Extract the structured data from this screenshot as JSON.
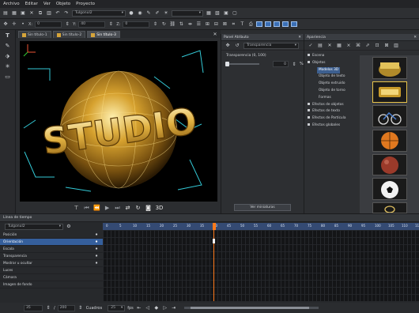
{
  "menu": [
    "Archivo",
    "Editar",
    "Ver",
    "Objeto",
    "Proyecto"
  ],
  "toolbar": {
    "font_value": "Tulgonul2"
  },
  "coords": {
    "x_label": "X:",
    "x_value": "0",
    "y_label": "Y:",
    "y_value": "40",
    "z_label": "Z:",
    "z_value": "0"
  },
  "tabs": [
    "Sin título-1",
    "Sin título-2",
    "Sin título-3"
  ],
  "viewport": {
    "text": "STUDIO",
    "mode_label": "3D"
  },
  "attr_panel": {
    "title": "Panel Atributo",
    "combo": "Transparencia",
    "label": "Transparencia (0, 100)",
    "value": "0",
    "unit": "%",
    "button": "Ver miniaturas"
  },
  "apariencia": {
    "title": "Apariencia",
    "tree": [
      {
        "label": "Escena",
        "level": 0
      },
      {
        "label": "Objetos",
        "level": 0
      },
      {
        "label": "Modelos 3D",
        "level": 1,
        "selected": true
      },
      {
        "label": "Objeto de texto",
        "level": 1
      },
      {
        "label": "Objeto extruido",
        "level": 1
      },
      {
        "label": "Objeto de torno",
        "level": 1
      },
      {
        "label": "Formas",
        "level": 1
      },
      {
        "label": "Efectos de objetos",
        "level": 0
      },
      {
        "label": "Efectos de texto",
        "level": 0
      },
      {
        "label": "Efectos de Partícula",
        "level": 0
      },
      {
        "label": "Efectos globales",
        "level": 0
      }
    ]
  },
  "thumbnails": [
    "studio-gold",
    "studio-badge",
    "bicycle",
    "basketball",
    "ball-red",
    "soccer-ball",
    "ring"
  ],
  "timeline": {
    "title": "Línea de tiempo",
    "object": "Tulgonul2",
    "tracks": [
      {
        "label": "Posición"
      },
      {
        "label": "Orientación",
        "selected": true
      },
      {
        "label": "Escala"
      },
      {
        "label": "Transparencia"
      },
      {
        "label": "Mostrar u ocultar"
      },
      {
        "label": "Luces"
      },
      {
        "label": "Cámara"
      },
      {
        "label": "Imagen de fondo"
      }
    ],
    "ruler": [
      "0",
      "5",
      "10",
      "15",
      "20",
      "25",
      "30",
      "35",
      "40",
      "45",
      "50",
      "55",
      "60",
      "65",
      "70",
      "75",
      "80",
      "85",
      "90",
      "95",
      "100",
      "105",
      "110",
      "115"
    ],
    "frame_current": "35",
    "frame_total": "200",
    "frames_label": "Cuadros",
    "fps": "25",
    "fps_unit": "fps",
    "playhead_frame": 40
  }
}
